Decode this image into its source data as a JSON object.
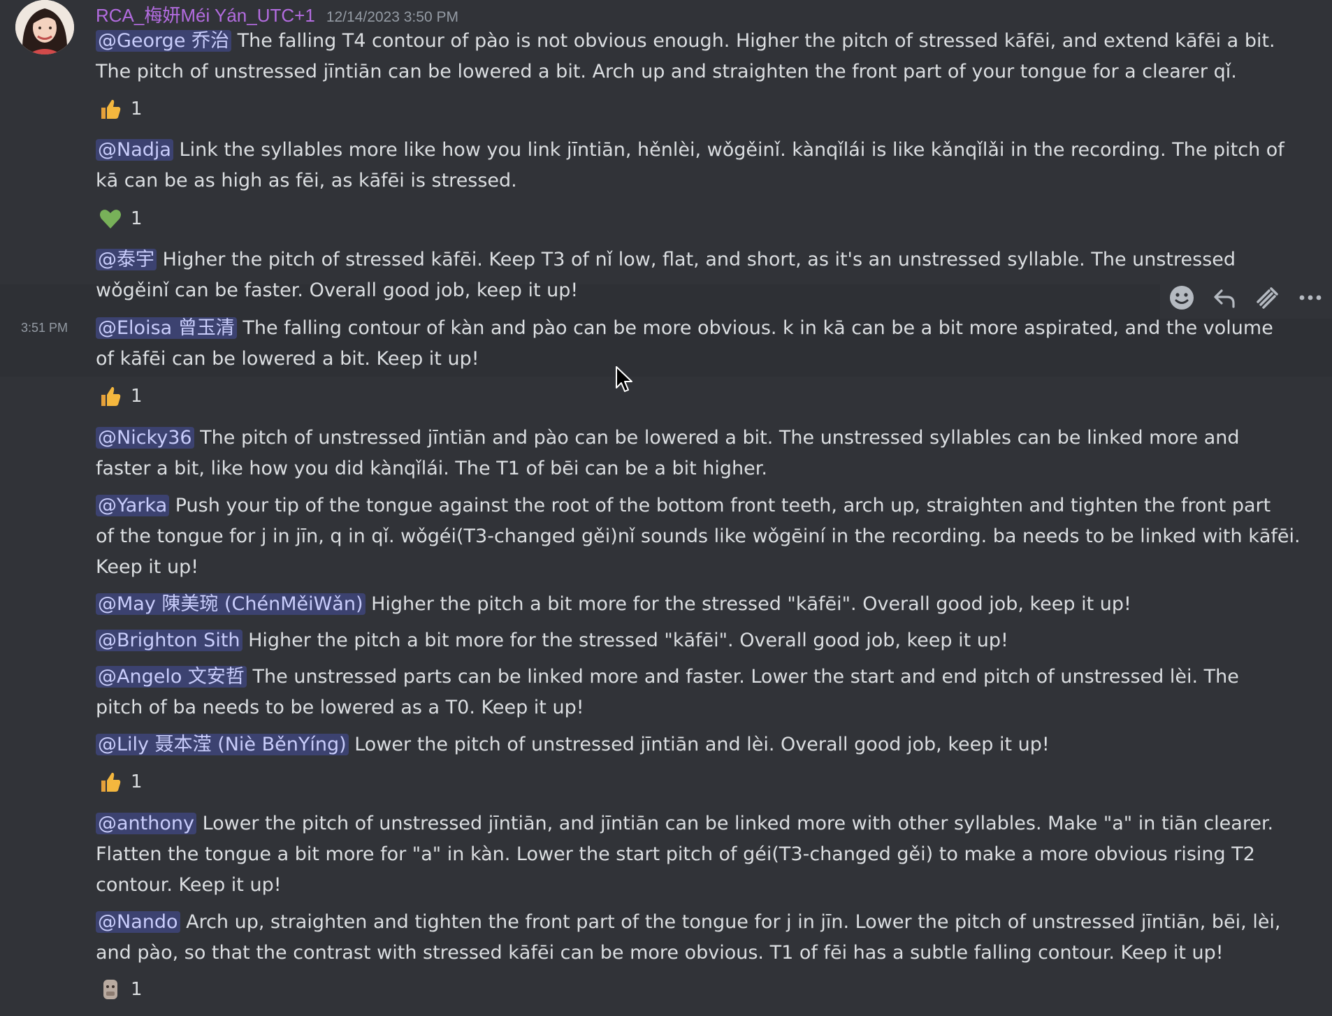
{
  "header": {
    "username": "RCA_梅妍Méi Yán_UTC+1",
    "timestamp": "12/14/2023 3:50 PM",
    "side_time": "3:51 PM"
  },
  "messages": [
    {
      "mention": "@George 乔治",
      "lines": [
        "The falling T4 contour of pào is not obvious enough. Higher the pitch of stressed kāfēi, and extend kāfēi a bit.",
        "The pitch of unstressed jīntiān can be lowered a bit. Arch up and straighten the front part of your tongue for a clearer qǐ."
      ]
    },
    {
      "mention": "@Nadja",
      "lines": [
        "Link the syllables more like how you link jīntiān, hěnlèi, wǒgěinǐ. kànqǐlái is like kǎnqǐlǎi in the recording. The pitch of",
        "kā can be as high as fēi, as kāfēi is stressed."
      ]
    },
    {
      "mention": "@泰宇",
      "lines": [
        "Higher the pitch of stressed kāfēi. Keep T3 of nǐ low, flat, and short, as it's an unstressed syllable. The unstressed",
        "wǒgěinǐ can be faster. Overall good job, keep it up!"
      ]
    },
    {
      "mention": "@Eloisa 曾玉清",
      "lines": [
        "The falling contour of kàn and pào can be more obvious. k in kā can be a bit more aspirated, and the volume",
        "of kāfēi can be lowered a bit. Keep it up!"
      ]
    },
    {
      "mention": "@Nicky36",
      "lines": [
        "The pitch of unstressed jīntiān and pào can be lowered a bit. The unstressed syllables can be linked more and",
        "faster a bit, like how you did kànqǐlái. The T1 of bēi can be a bit higher."
      ]
    },
    {
      "mention": "@Yarka",
      "lines": [
        "Push your tip of the tongue against the root of the bottom front teeth, arch up, straighten and tighten the front part",
        "of the tongue for j in jīn, q in qǐ. wǒgéi(T3-changed gěi)nǐ sounds like wǒgēiní in the recording. ba needs to be linked with kāfēi.",
        "Keep it up!"
      ]
    },
    {
      "mention": "@May 陳美琬 (ChénMěiWǎn)",
      "lines": [
        "Higher the pitch a bit more for the stressed \"kāfēi\". Overall good job, keep it up!"
      ]
    },
    {
      "mention": "@Brighton Sith",
      "lines": [
        "Higher the pitch a bit more for the stressed \"kāfēi\". Overall good job, keep it up!"
      ]
    },
    {
      "mention": "@Angelo 文安哲",
      "lines": [
        "The unstressed parts can be linked more and faster. Lower the start and end pitch of unstressed lèi. The",
        "pitch of ba needs to be lowered as a T0. Keep it up!"
      ]
    },
    {
      "mention": "@Lily 聂本滢 (Niè BěnYíng)",
      "lines": [
        "Lower the pitch of unstressed jīntiān and lèi. Overall good job, keep it up!"
      ]
    },
    {
      "mention": "@anthony",
      "lines": [
        "Lower the pitch of unstressed jīntiān, and jīntiān can be linked more with other syllables. Make \"a\" in tiān clearer.",
        "Flatten the tongue a bit more for \"a\" in kàn. Lower the start pitch of géi(T3-changed gěi) to make a more obvious rising T2",
        "contour. Keep it up!"
      ]
    },
    {
      "mention": "@Nando",
      "lines": [
        "Arch up, straighten and tighten the front part of the tongue for j in jīn. Lower the pitch of unstressed jīntiān, bēi, lèi,",
        "and pào, so that the contrast with stressed kāfēi can be more obvious. T1 of fēi has a subtle falling contour. Keep it up!"
      ]
    }
  ],
  "reactions": [
    {
      "icon": "thumbs-up-icon",
      "count": "1"
    },
    {
      "icon": "green-heart-icon",
      "count": "1"
    },
    {
      "icon": "thumbs-up-icon",
      "count": "1"
    },
    {
      "icon": "thumbs-up-icon",
      "count": "1"
    },
    {
      "icon": "sticker-emoji-icon",
      "count": "1"
    }
  ],
  "toolbar": {
    "icons": [
      "add-reaction-icon",
      "reply-icon",
      "create-thread-icon",
      "more-options-icon"
    ]
  },
  "colors": {
    "background": "#313338",
    "username": "#b36ce0",
    "mention_bg": "#3c4270",
    "mention_text": "#c9cdfb",
    "text": "#dbdee1",
    "muted": "#949ba4"
  }
}
